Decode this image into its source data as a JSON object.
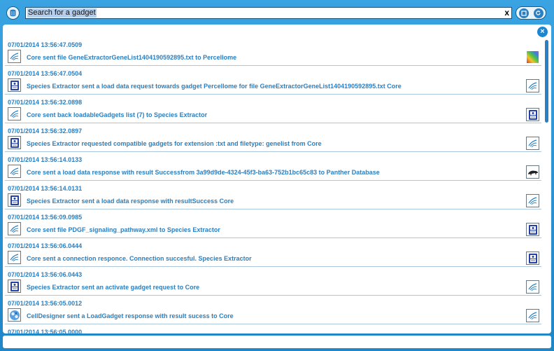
{
  "search": {
    "placeholder": "Search for a gadget",
    "value": "Search for a gadget",
    "clear_label": "x"
  },
  "close_label": "×",
  "logs": [
    {
      "time": "07/01/2014 13:56:47.0509",
      "msg": "Core sent file GeneExtractorGeneList1404190592895.txt to  Percellome",
      "src": "core",
      "dst": "percellome"
    },
    {
      "time": "07/01/2014 13:56:47.0504",
      "msg": "Species Extractor sent a load data request towards gadget Percellome for file GeneExtractorGeneList1404190592895.txt Core",
      "src": "species",
      "dst": "core"
    },
    {
      "time": "07/01/2014 13:56:32.0898",
      "msg": "Core sent back loadableGadgets list (7) to Species Extractor",
      "src": "core",
      "dst": "species"
    },
    {
      "time": "07/01/2014 13:56:32.0897",
      "msg": "Species Extractor requested compatible gadgets for extension :txt and filetype: genelist from Core",
      "src": "species",
      "dst": "core"
    },
    {
      "time": "07/01/2014 13:56:14.0133",
      "msg": "Core sent a load data response with result Successfrom 3a99d9de-4324-45f3-ba63-752b1bc65c83 to Panther Database",
      "src": "core",
      "dst": "panther"
    },
    {
      "time": "07/01/2014 13:56:14.0131",
      "msg": "Species Extractor sent a load data response with resultSuccess Core",
      "src": "species",
      "dst": "core"
    },
    {
      "time": "07/01/2014 13:56:09.0985",
      "msg": "Core sent file PDGF_signaling_pathway.xml to  Species Extractor",
      "src": "core",
      "dst": "species"
    },
    {
      "time": "07/01/2014 13:56:06.0444",
      "msg": "Core sent a connection responce. Connection succesful. Species Extractor",
      "src": "core",
      "dst": "species"
    },
    {
      "time": "07/01/2014 13:56:06.0443",
      "msg": "Species Extractor sent an activate gadget request to Core",
      "src": "species",
      "dst": "core"
    },
    {
      "time": "07/01/2014 13:56:05.0012",
      "msg": "CellDesigner sent a LoadGadget response with result sucess to Core",
      "src": "celldesigner",
      "dst": "core"
    },
    {
      "time": "07/01/2014 13:56:05.0000",
      "msg": "",
      "src": "",
      "dst": ""
    }
  ],
  "colors": {
    "accent": "#2a7fc0",
    "frame": "#2a95d6",
    "divider": "#aac6dd"
  }
}
